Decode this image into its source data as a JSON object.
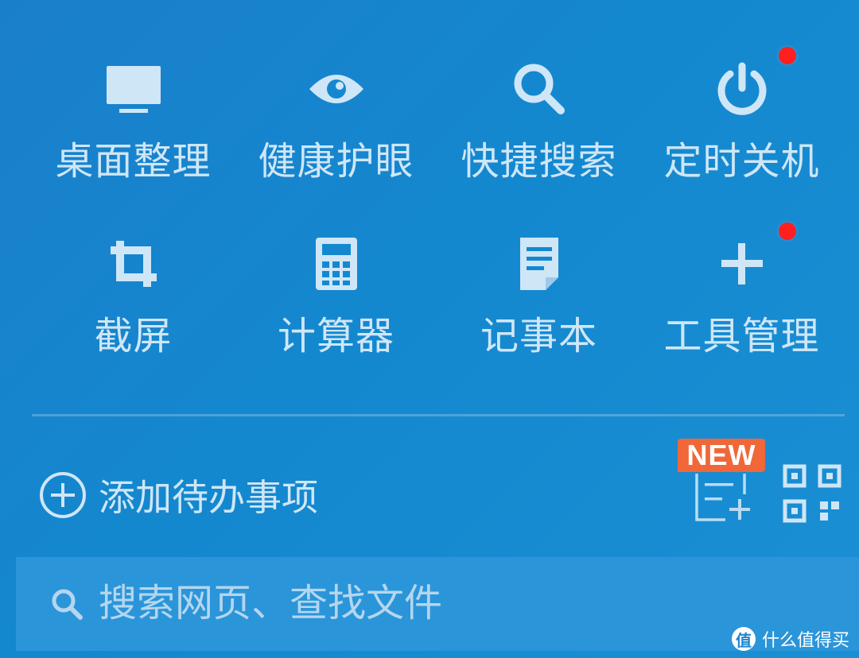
{
  "tools": [
    {
      "label": "桌面整理",
      "icon": "monitor-icon"
    },
    {
      "label": "健康护眼",
      "icon": "eye-icon"
    },
    {
      "label": "快捷搜索",
      "icon": "search-icon"
    },
    {
      "label": "定时关机",
      "icon": "power-icon",
      "badge": "red-dot"
    },
    {
      "label": "截屏",
      "icon": "crop-icon"
    },
    {
      "label": "计算器",
      "icon": "calculator-icon"
    },
    {
      "label": "记事本",
      "icon": "notepad-icon"
    },
    {
      "label": "工具管理",
      "icon": "plus-icon",
      "badge": "red-dot"
    }
  ],
  "todo": {
    "label": "添加待办事项",
    "icon": "add-circle-icon"
  },
  "new_badge": "NEW",
  "search": {
    "placeholder": "搜索网页、查找文件",
    "icon": "search-icon"
  },
  "watermark": {
    "text": "什么值得买",
    "logo_char": "值"
  },
  "colors": {
    "background": "#1488cf",
    "icon": "#cfe6f7",
    "badge_dot": "#ff1f1f",
    "new_badge": "#f0673a",
    "search_bar": "#2b95d9"
  }
}
